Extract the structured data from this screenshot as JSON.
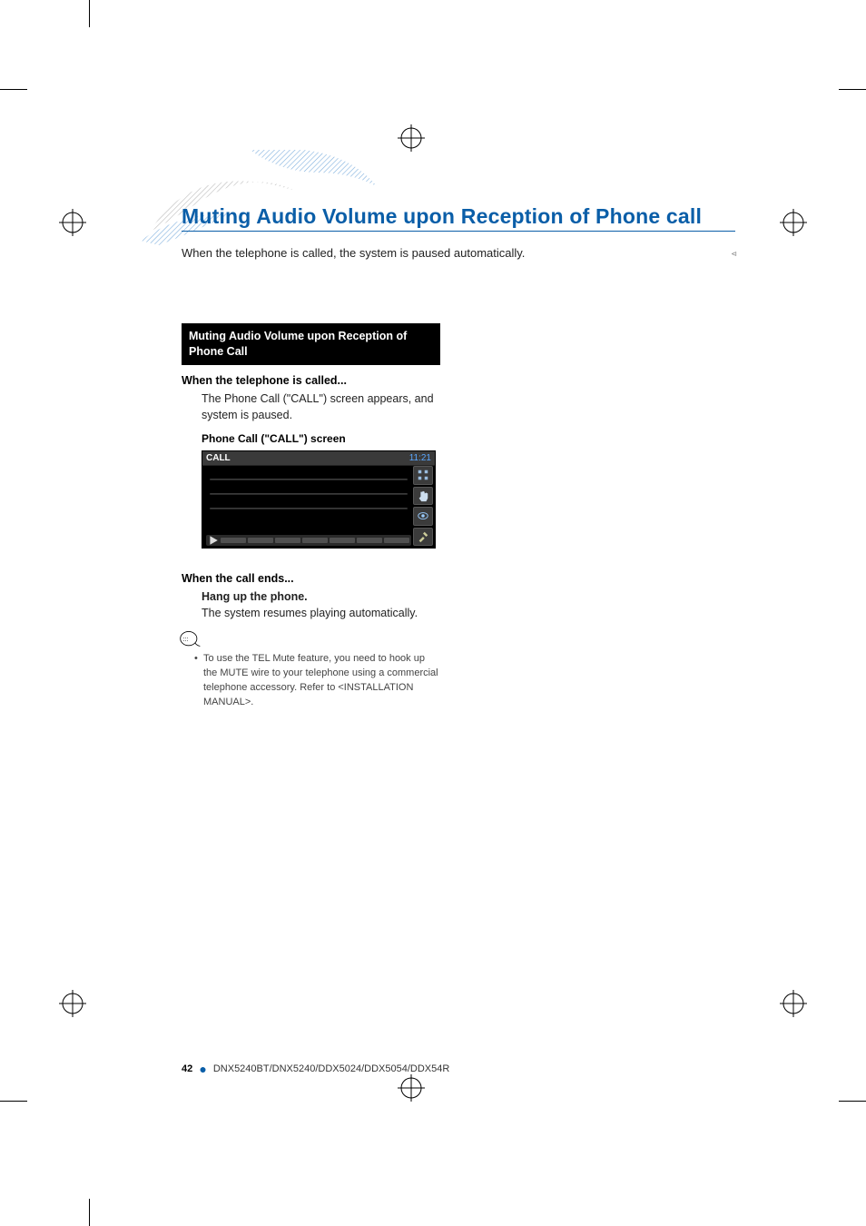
{
  "page": {
    "title": "Muting Audio Volume upon Reception of Phone call",
    "intro": "When the telephone is called, the system is paused automatically."
  },
  "section": {
    "box_heading": "Muting Audio Volume upon Reception of Phone Call",
    "when_called": {
      "heading": "When the telephone is called...",
      "body": "The Phone Call (\"CALL\") screen appears, and system is paused.",
      "screen_label": "Phone Call (\"CALL\") screen"
    },
    "call_screen": {
      "top_left": "CALL",
      "top_right": "11:21"
    },
    "when_ends": {
      "heading": "When the call ends...",
      "sub": "Hang up the phone.",
      "body": "The system resumes playing automatically."
    },
    "note": "To use the TEL Mute feature, you need to hook up the MUTE wire to your telephone using a commercial telephone accessory. Refer to <INSTALLATION MANUAL>."
  },
  "footer": {
    "page_num": "42",
    "models": "DNX5240BT/DNX5240/DDX5024/DDX5054/DDX54R"
  }
}
